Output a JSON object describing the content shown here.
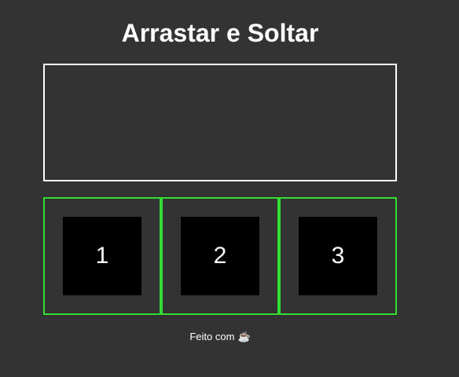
{
  "page": {
    "title": "Arrastar e Soltar"
  },
  "boxes": [
    {
      "label": "1"
    },
    {
      "label": "2"
    },
    {
      "label": "3"
    }
  ],
  "footer": {
    "text": "Feito com",
    "icon_glyph": "☕",
    "icon": "coffee-icon"
  },
  "colors": {
    "background": "#333333",
    "drop_border": "#ffffff",
    "slot_border": "#33dd33",
    "box": "#000000",
    "text": "#ffffff"
  }
}
